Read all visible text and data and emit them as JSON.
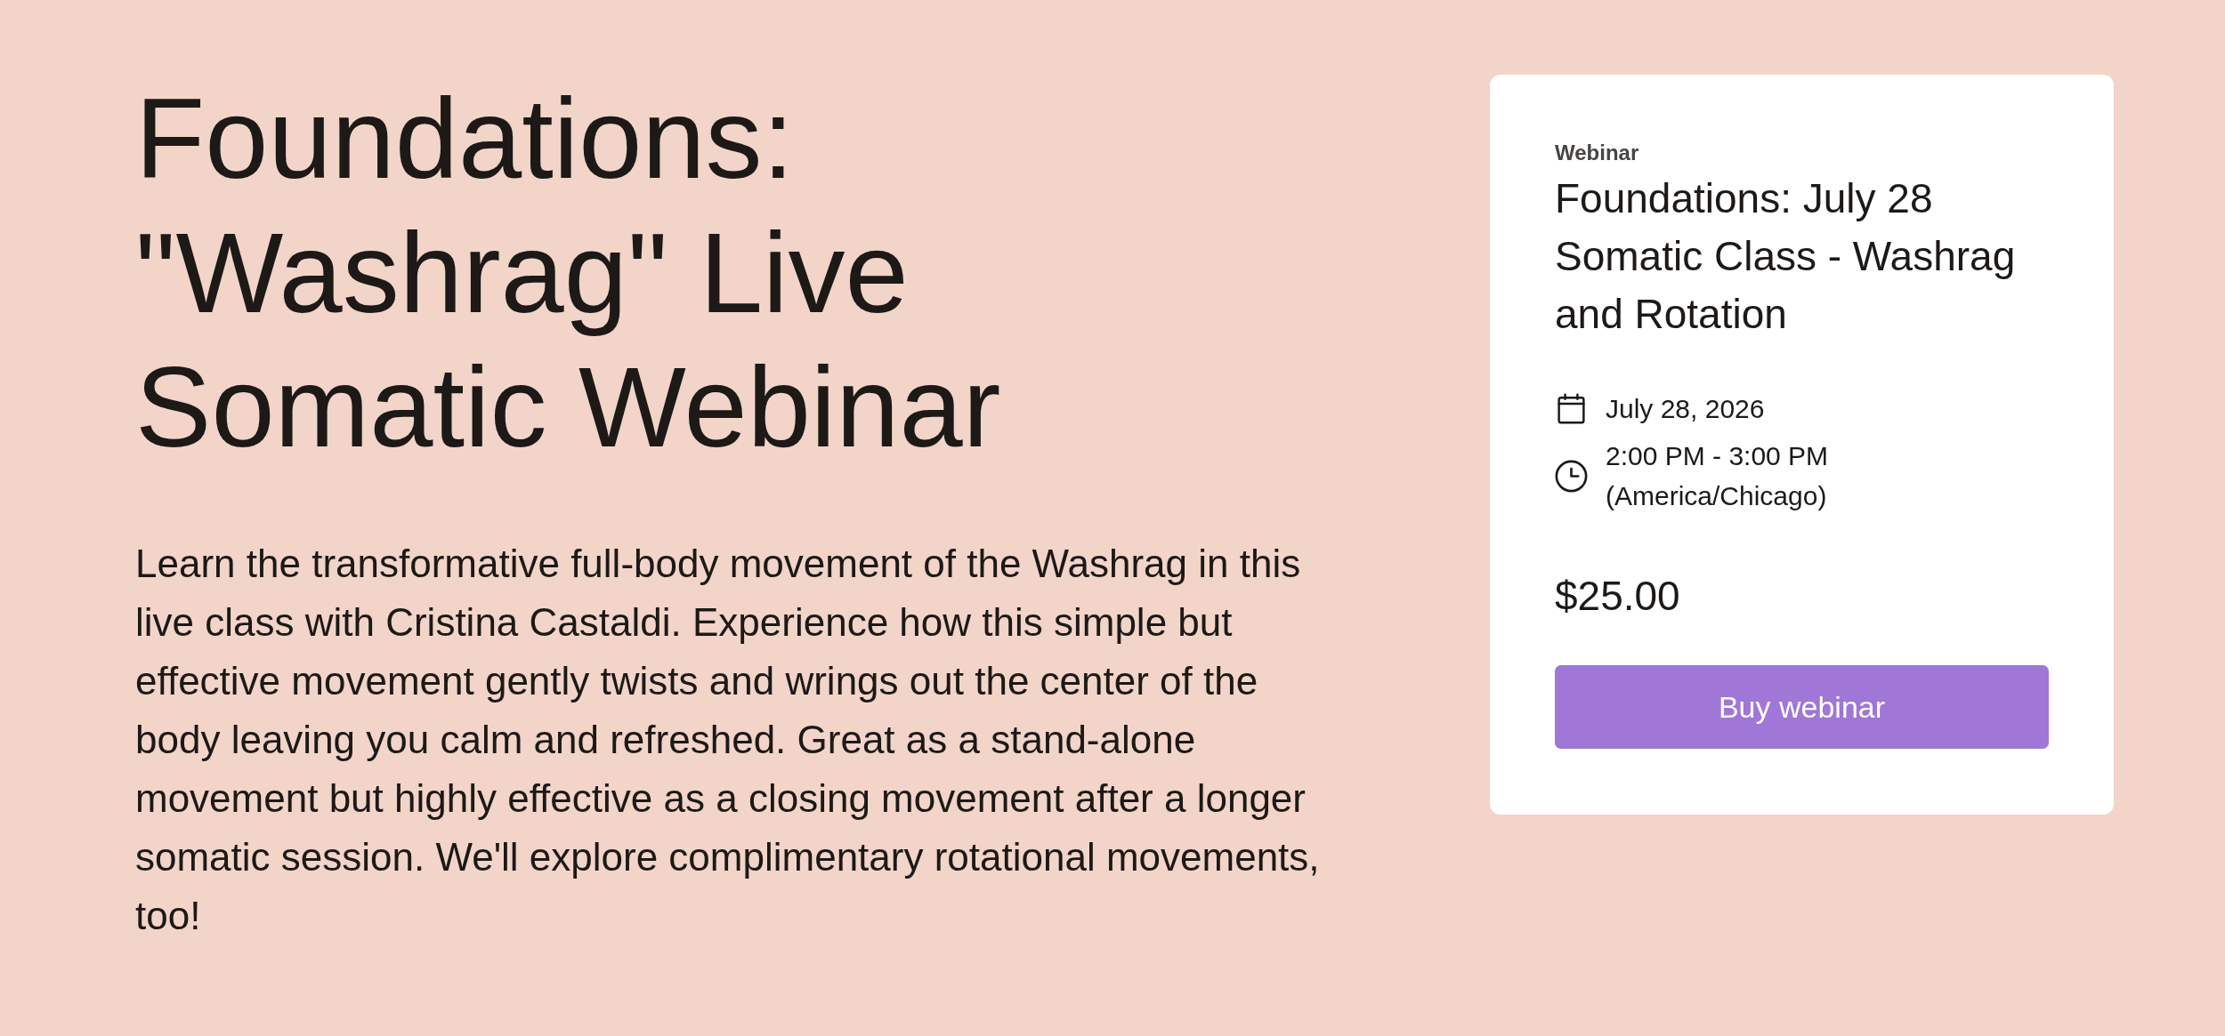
{
  "event": {
    "title": "Foundations: \"Washrag\" Live Somatic Webinar",
    "description": "Learn the transformative full-body movement of the Washrag in this live class with Cristina Castaldi. Experience how this simple but effective movement gently twists and wrings out the center of the body leaving you calm and refreshed. Great as a stand-alone movement but highly effective as a closing movement after a longer somatic session. We'll explore complimentary rotational movements, too!"
  },
  "card": {
    "label": "Webinar",
    "title": "Foundations: July 28 Somatic Class - Washrag and Rotation",
    "details": [
      {
        "kind": "date",
        "text": "July 28, 2026"
      },
      {
        "kind": "time",
        "text": "2:00 PM - 3:00 PM (America/Chicago)"
      }
    ],
    "price": "$25.00",
    "button": "Buy webinar"
  }
}
